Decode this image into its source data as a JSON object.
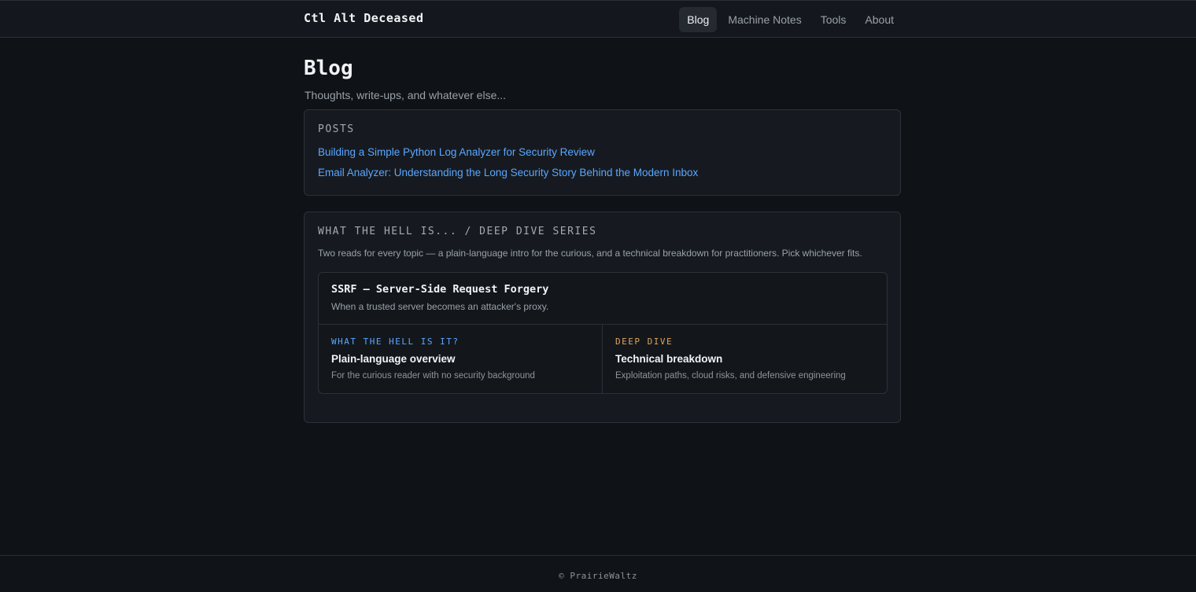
{
  "header": {
    "brand": "Ctl Alt Deceased",
    "nav": [
      {
        "label": "Blog",
        "active": true
      },
      {
        "label": "Machine Notes",
        "active": false
      },
      {
        "label": "Tools",
        "active": false
      },
      {
        "label": "About",
        "active": false
      }
    ]
  },
  "main": {
    "title": "Blog",
    "subtitle": "Thoughts, write-ups, and whatever else...",
    "posts": {
      "heading": "POSTS",
      "items": [
        "Building a Simple Python Log Analyzer for Security Review",
        "Email Analyzer: Understanding the Long Security Story Behind the Modern Inbox"
      ]
    },
    "series": {
      "heading": "WHAT THE HELL IS... / DEEP DIVE SERIES",
      "description": "Two reads for every topic — a plain-language intro for the curious, and a technical breakdown for practitioners. Pick whichever fits.",
      "topics": [
        {
          "title": "SSRF — Server-Side Request Forgery",
          "subtitle": "When a trusted server becomes an attacker's proxy.",
          "reads": [
            {
              "kicker": "WHAT THE HELL IS IT?",
              "title": "Plain-language overview",
              "desc": "For the curious reader with no security background"
            },
            {
              "kicker": "DEEP DIVE",
              "title": "Technical breakdown",
              "desc": "Exploitation paths, cloud risks, and defensive engineering"
            }
          ]
        }
      ]
    }
  },
  "footer": {
    "text": "© PrairieWaltz"
  },
  "colors": {
    "background": "#0f1216",
    "link": "#5aa7ff",
    "kicker_intro": "#5aa7ff",
    "kicker_deep": "#e0a458"
  }
}
